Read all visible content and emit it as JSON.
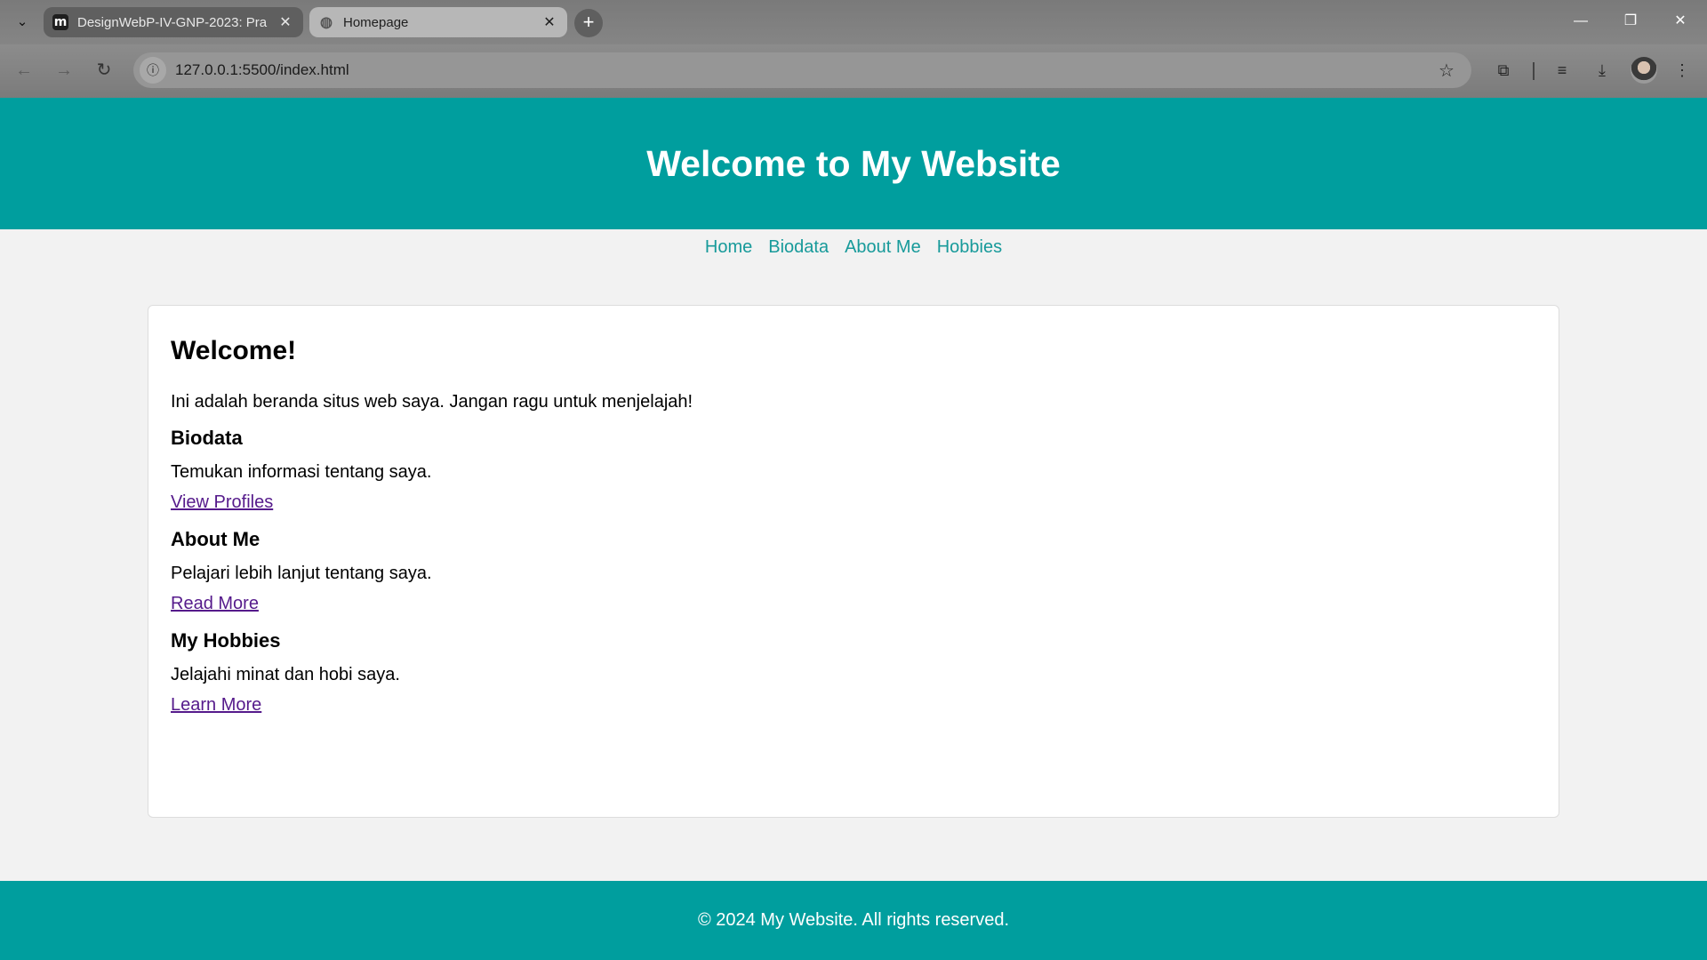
{
  "browser": {
    "tabs": [
      {
        "title": "DesignWebP-IV-GNP-2023: Pra",
        "favicon": "moodle-m-icon",
        "active": false
      },
      {
        "title": "Homepage",
        "favicon": "globe-icon",
        "active": true
      }
    ],
    "url": "127.0.0.1:5500/index.html",
    "icons": {
      "back": "arrow-left-icon",
      "forward": "arrow-right-icon",
      "reload": "reload-icon",
      "site_info": "info-icon",
      "bookmark": "star-icon",
      "extensions": "puzzle-icon",
      "media": "media-queue-icon",
      "downloads": "download-icon",
      "menu": "kebab-menu-icon"
    }
  },
  "header": {
    "title": "Welcome to My Website"
  },
  "nav": {
    "items": [
      "Home",
      "Biodata",
      "About Me",
      "Hobbies"
    ]
  },
  "main": {
    "heading": "Welcome!",
    "intro": "Ini adalah beranda situs web saya. Jangan ragu untuk menjelajah!",
    "sections": [
      {
        "title": "Biodata",
        "text": "Temukan informasi tentang saya.",
        "link": "View Profiles"
      },
      {
        "title": "About Me",
        "text": "Pelajari lebih lanjut tentang saya.",
        "link": "Read More"
      },
      {
        "title": "My Hobbies",
        "text": "Jelajahi minat dan hobi saya.",
        "link": "Learn More"
      }
    ]
  },
  "footer": {
    "text": "© 2024 My Website. All rights reserved."
  },
  "colors": {
    "brand": "#009e9e",
    "nav_link": "#179a9a",
    "visited_link": "#551a8b"
  }
}
